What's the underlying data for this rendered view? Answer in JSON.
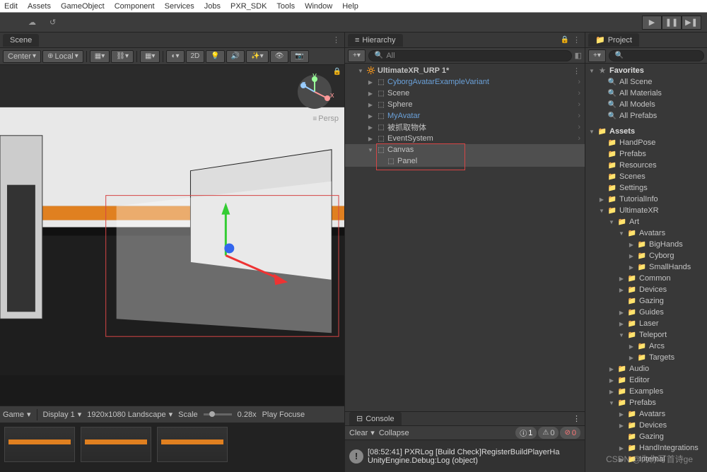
{
  "menu": [
    "Edit",
    "Assets",
    "GameObject",
    "Component",
    "Services",
    "Jobs",
    "PXR_SDK",
    "Tools",
    "Window",
    "Help"
  ],
  "tabs": {
    "scene": "Scene",
    "hierarchy": "Hierarchy",
    "project": "Project",
    "console": "Console"
  },
  "sceneToolbar": {
    "center": "Center",
    "local": "Local",
    "twoD": "2D"
  },
  "sceneBottom": {
    "game": "Game",
    "display": "Display 1",
    "resolution": "1920x1080 Landscape",
    "scaleLabel": "Scale",
    "scaleVal": "0.28x",
    "playMode": "Play Focuse"
  },
  "perspLabel": "Persp",
  "hierarchy": {
    "searchPlaceholder": "All",
    "root": "UltimateXR_URP 1*",
    "items": [
      {
        "label": "CyborgAvatarExampleVariant",
        "color": "#6aa0d8"
      },
      {
        "label": "Scene",
        "color": "#c4c4c4"
      },
      {
        "label": "Sphere",
        "color": "#c4c4c4"
      },
      {
        "label": "MyAvatar",
        "color": "#6aa0d8"
      },
      {
        "label": "被抓取物体",
        "color": "#c4c4c4"
      },
      {
        "label": "EventSystem",
        "color": "#c4c4c4"
      }
    ],
    "canvas": "Canvas",
    "panel": "Panel"
  },
  "console": {
    "clear": "Clear",
    "collapse": "Collapse",
    "info": "1",
    "warn": "0",
    "error": "0",
    "msgLine1": "[08:52:41] PXRLog [Build Check]RegisterBuildPlayerHa",
    "msgLine2": "UnityEngine.Debug:Log (object)"
  },
  "project": {
    "favoritesHeader": "Favorites",
    "favorites": [
      "All Scene",
      "All Materials",
      "All Models",
      "All Prefabs"
    ],
    "assetsHeader": "Assets",
    "tree": [
      {
        "l": 1,
        "a": "",
        "i": "📁",
        "t": "HandPose"
      },
      {
        "l": 1,
        "a": "",
        "i": "📁",
        "t": "Prefabs"
      },
      {
        "l": 1,
        "a": "",
        "i": "📁",
        "t": "Resources"
      },
      {
        "l": 1,
        "a": "",
        "i": "📁",
        "t": "Scenes"
      },
      {
        "l": 1,
        "a": "",
        "i": "📁",
        "t": "Settings"
      },
      {
        "l": 1,
        "a": "▶",
        "i": "📁",
        "t": "TutorialInfo"
      },
      {
        "l": 1,
        "a": "▼",
        "i": "📁",
        "t": "UltimateXR"
      },
      {
        "l": 2,
        "a": "▼",
        "i": "📁",
        "t": "Art"
      },
      {
        "l": 3,
        "a": "▼",
        "i": "📁",
        "t": "Avatars"
      },
      {
        "l": 4,
        "a": "▶",
        "i": "📁",
        "t": "BigHands"
      },
      {
        "l": 4,
        "a": "▶",
        "i": "📁",
        "t": "Cyborg"
      },
      {
        "l": 4,
        "a": "▶",
        "i": "📁",
        "t": "SmallHands"
      },
      {
        "l": 3,
        "a": "▶",
        "i": "📁",
        "t": "Common"
      },
      {
        "l": 3,
        "a": "▶",
        "i": "📁",
        "t": "Devices"
      },
      {
        "l": 3,
        "a": "",
        "i": "📁",
        "t": "Gazing"
      },
      {
        "l": 3,
        "a": "▶",
        "i": "📁",
        "t": "Guides"
      },
      {
        "l": 3,
        "a": "▶",
        "i": "📁",
        "t": "Laser"
      },
      {
        "l": 3,
        "a": "▼",
        "i": "📁",
        "t": "Teleport"
      },
      {
        "l": 4,
        "a": "▶",
        "i": "📁",
        "t": "Arcs"
      },
      {
        "l": 4,
        "a": "▶",
        "i": "📁",
        "t": "Targets"
      },
      {
        "l": 2,
        "a": "▶",
        "i": "📁",
        "t": "Audio"
      },
      {
        "l": 2,
        "a": "▶",
        "i": "📁",
        "t": "Editor"
      },
      {
        "l": 2,
        "a": "▶",
        "i": "📁",
        "t": "Examples"
      },
      {
        "l": 2,
        "a": "▼",
        "i": "📁",
        "t": "Prefabs"
      },
      {
        "l": 3,
        "a": "▶",
        "i": "📁",
        "t": "Avatars"
      },
      {
        "l": 3,
        "a": "▶",
        "i": "📁",
        "t": "Devices"
      },
      {
        "l": 3,
        "a": "",
        "i": "📁",
        "t": "Gazing"
      },
      {
        "l": 3,
        "a": "▶",
        "i": "📁",
        "t": "HandIntegrations"
      },
      {
        "l": 3,
        "a": "▶",
        "i": "📁",
        "t": "Internal"
      }
    ]
  },
  "watermark": "CSDN @为你写首诗ge"
}
